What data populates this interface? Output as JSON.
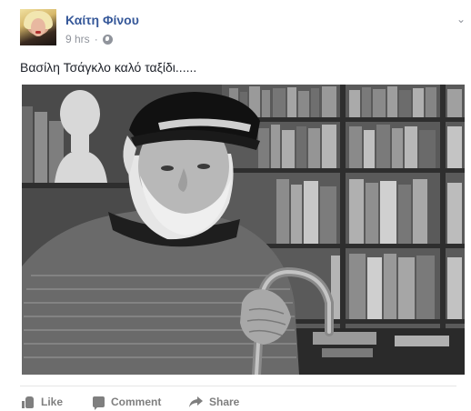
{
  "post": {
    "author": "Καίτη Φίνου",
    "time": "9 hrs",
    "separator": "·",
    "privacy_icon": "globe-icon",
    "menu_icon": "chevron-down-icon",
    "text": "Βασίλη Τσάγκλο καλό ταξίδι......",
    "photo_icon": "photo-of-elderly-man-in-cap-with-cane"
  },
  "actions": {
    "like": "Like",
    "comment": "Comment",
    "share": "Share"
  },
  "colors": {
    "author_link": "#365899",
    "meta_gray": "#90949c",
    "action_gray": "#7f7f7f",
    "divider": "#e5e5e5"
  }
}
